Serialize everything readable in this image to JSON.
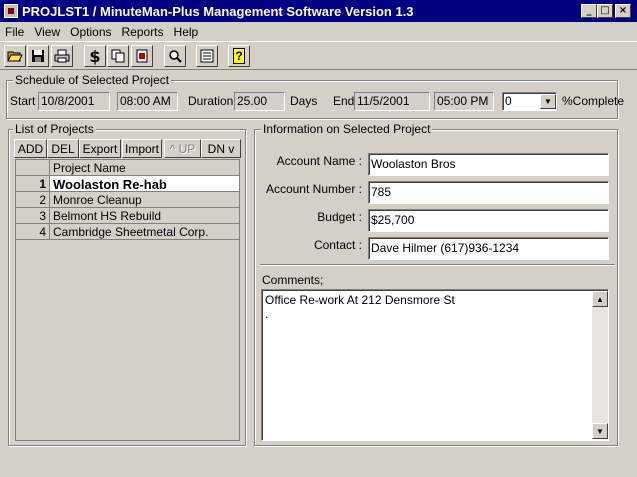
{
  "window": {
    "title": "PROJLST1  /  MinuteMan-Plus Management Software Version 1.3"
  },
  "caption_buttons": {
    "minimize": "_",
    "maximize": "□",
    "close": "×"
  },
  "menu": [
    "File",
    "View",
    "Options",
    "Reports",
    "Help"
  ],
  "toolbar": [
    "open-icon",
    "save-icon",
    "print-icon",
    "dollar-icon",
    "copy-icon",
    "delete-icon",
    "zoom-icon",
    "report-icon",
    "help-icon"
  ],
  "toolbar_glyphs": {
    "dollar": "$",
    "help": "?"
  },
  "schedule": {
    "group_label": "Schedule of Selected Project",
    "start_label": "Start :",
    "start_date": "10/8/2001",
    "start_time": "08:00 AM",
    "duration_label": "Duration:",
    "duration": "25.00",
    "days_label": "Days",
    "end_label": "End",
    "end_date": "11/5/2001",
    "end_time": "05:00 PM",
    "complete_value": "0",
    "complete_label": "%Complete"
  },
  "projects": {
    "group_label": "List of Projects",
    "buttons": {
      "add": "ADD",
      "del": "DEL",
      "export": "Export",
      "import": "Import",
      "up": "^ UP",
      "dn": "DN v"
    },
    "column_header": "Project Name",
    "rows": [
      {
        "num": "1",
        "name": "Woolaston Re-hab"
      },
      {
        "num": "2",
        "name": "Monroe Cleanup"
      },
      {
        "num": "3",
        "name": "Belmont HS  Rebuild"
      },
      {
        "num": "4",
        "name": "Cambridge Sheetmetal Corp."
      }
    ]
  },
  "info": {
    "group_label": "Information on Selected Project",
    "account_name_label": "Account Name :",
    "account_name": "Woolaston Bros",
    "account_number_label": "Account Number :",
    "account_number": "785",
    "budget_label": "Budget :",
    "budget": "$25,700",
    "contact_label": "Contact :",
    "contact": "Dave Hilmer (617)936-1234",
    "comments_label": "Comments;",
    "comments_line1": "Office Re-work At 212 Densmore St",
    "comments_line2": "."
  }
}
